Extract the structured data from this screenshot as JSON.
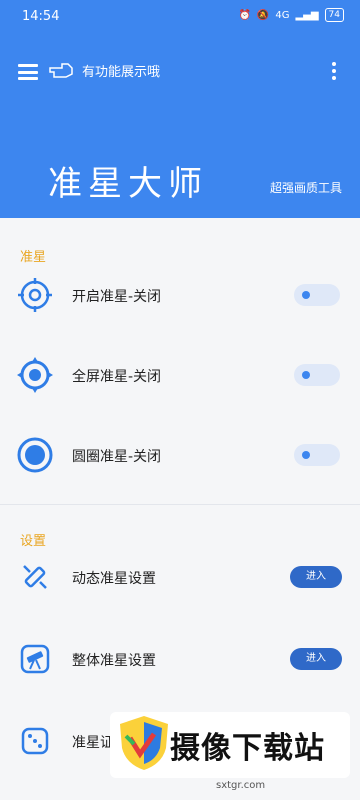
{
  "status": {
    "time": "14:54",
    "battery": "74",
    "network": "4G"
  },
  "header": {
    "hint": "有功能展示哦",
    "title": "准星大师",
    "subtitle": "超强画质工具"
  },
  "sections": {
    "crosshair": "准星",
    "settings": "设置"
  },
  "rows": [
    {
      "label": "开启准星-关闭"
    },
    {
      "label": "全屏准星-关闭"
    },
    {
      "label": "圆圈准星-关闭"
    },
    {
      "label": "动态准星设置",
      "button": "进入"
    },
    {
      "label": "整体准星设置",
      "button": "进入"
    },
    {
      "label": "准星证"
    }
  ],
  "watermark": {
    "text": "摄像下载站",
    "url": "sxtgr.com"
  },
  "colors": {
    "primary": "#3d86ef",
    "accent": "#e9a623",
    "button": "#2f69c8"
  }
}
